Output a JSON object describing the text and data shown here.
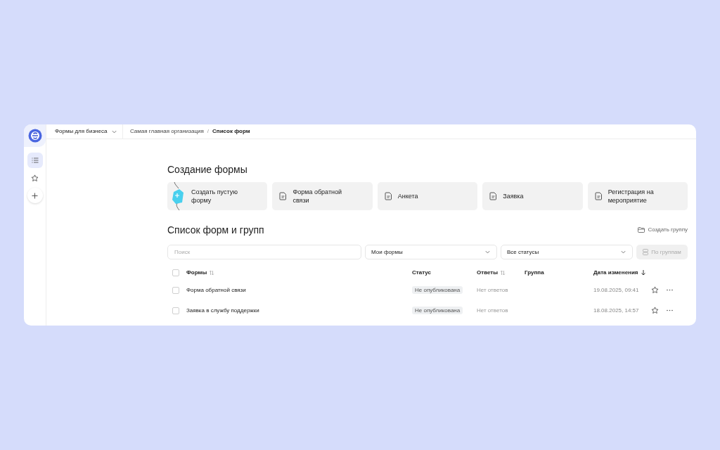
{
  "sidebar": {
    "items": [
      {
        "kind": "list",
        "selected": true
      },
      {
        "kind": "star",
        "selected": false
      },
      {
        "kind": "plus",
        "selected": false
      }
    ]
  },
  "top_bar": {
    "product": "Формы для бизнеса",
    "breadcrumbs": [
      "Самая главная организация",
      "Список форм"
    ],
    "separator": "/"
  },
  "create": {
    "title": "Создание формы",
    "templates": [
      {
        "kind": "blank",
        "label": "Создать пустую форму"
      },
      {
        "kind": "doc",
        "label": "Форма обратной связи"
      },
      {
        "kind": "doc",
        "label": "Анкета"
      },
      {
        "kind": "doc",
        "label": "Заявка"
      },
      {
        "kind": "doc",
        "label": "Регистрация на мероприятие"
      }
    ]
  },
  "list": {
    "title": "Список форм и групп",
    "create_group": "Создать группу",
    "search": {
      "placeholder": "Поиск"
    },
    "filters": [
      "Мои формы",
      "Все статусы"
    ],
    "group_button": {
      "label": "По группам",
      "disabled": true
    },
    "columns": [
      {
        "label": "Формы",
        "sortable": true,
        "sorted": false
      },
      {
        "label": "Статус",
        "sortable": false,
        "sorted": false
      },
      {
        "label": "Ответы",
        "sortable": true,
        "sorted": false
      },
      {
        "label": "Группа",
        "sortable": false,
        "sorted": false
      },
      {
        "label": "Дата изменения",
        "sortable": true,
        "sorted": true
      }
    ],
    "all_checked": false,
    "rows": [
      {
        "checked": false,
        "name": "Форма обратной связи",
        "status": "Не опубликована",
        "answers": "Нет ответов",
        "date": "19.08.2025, 09:41",
        "favorite": false
      },
      {
        "checked": false,
        "name": "Заявка в службу поддержки",
        "status": "Не опубликована",
        "answers": "Нет ответов",
        "date": "18.08.2025, 14:57",
        "favorite": false
      }
    ]
  }
}
